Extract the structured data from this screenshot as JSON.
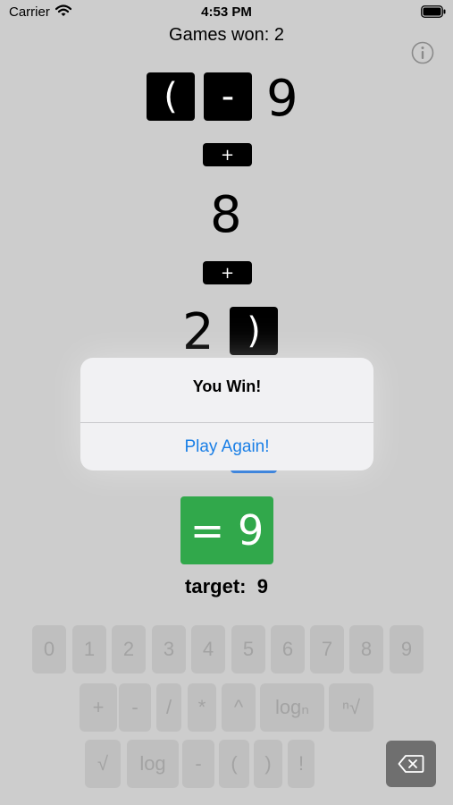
{
  "status_bar": {
    "carrier": "Carrier",
    "time": "4:53 PM"
  },
  "header": {
    "games_won": "Games won: 2"
  },
  "expression": {
    "row1": {
      "open_paren": "(",
      "minus": "-",
      "number": "9"
    },
    "op1": "+",
    "row2": {
      "number": "8"
    },
    "op2": "+",
    "row3": {
      "number": "2",
      "close_paren": ")"
    }
  },
  "alert": {
    "title": "You Win!",
    "button": "Play Again!"
  },
  "result": {
    "text": "= 9"
  },
  "target": {
    "label": "target:",
    "value": "9"
  },
  "keyboard": {
    "digits": [
      "0",
      "1",
      "2",
      "3",
      "4",
      "5",
      "6",
      "7",
      "8",
      "9"
    ],
    "ops1": [
      "+",
      "-",
      "/",
      "*",
      "^",
      "logₙ",
      "ⁿ√"
    ],
    "ops2": [
      "√",
      "log",
      "-",
      "(",
      ")",
      "!"
    ]
  },
  "colors": {
    "background": "#cdcdcd",
    "tile": "#000000",
    "result_green": "#31a84b",
    "alert_blue": "#1a7fe6",
    "key_bg": "#bfbfbf",
    "key_text": "#a3a3a3",
    "delete_key": "#6f6f6f"
  },
  "icons": {
    "wifi": "wifi-icon",
    "battery": "battery-icon",
    "info": "info-icon",
    "delete": "backspace-icon"
  }
}
